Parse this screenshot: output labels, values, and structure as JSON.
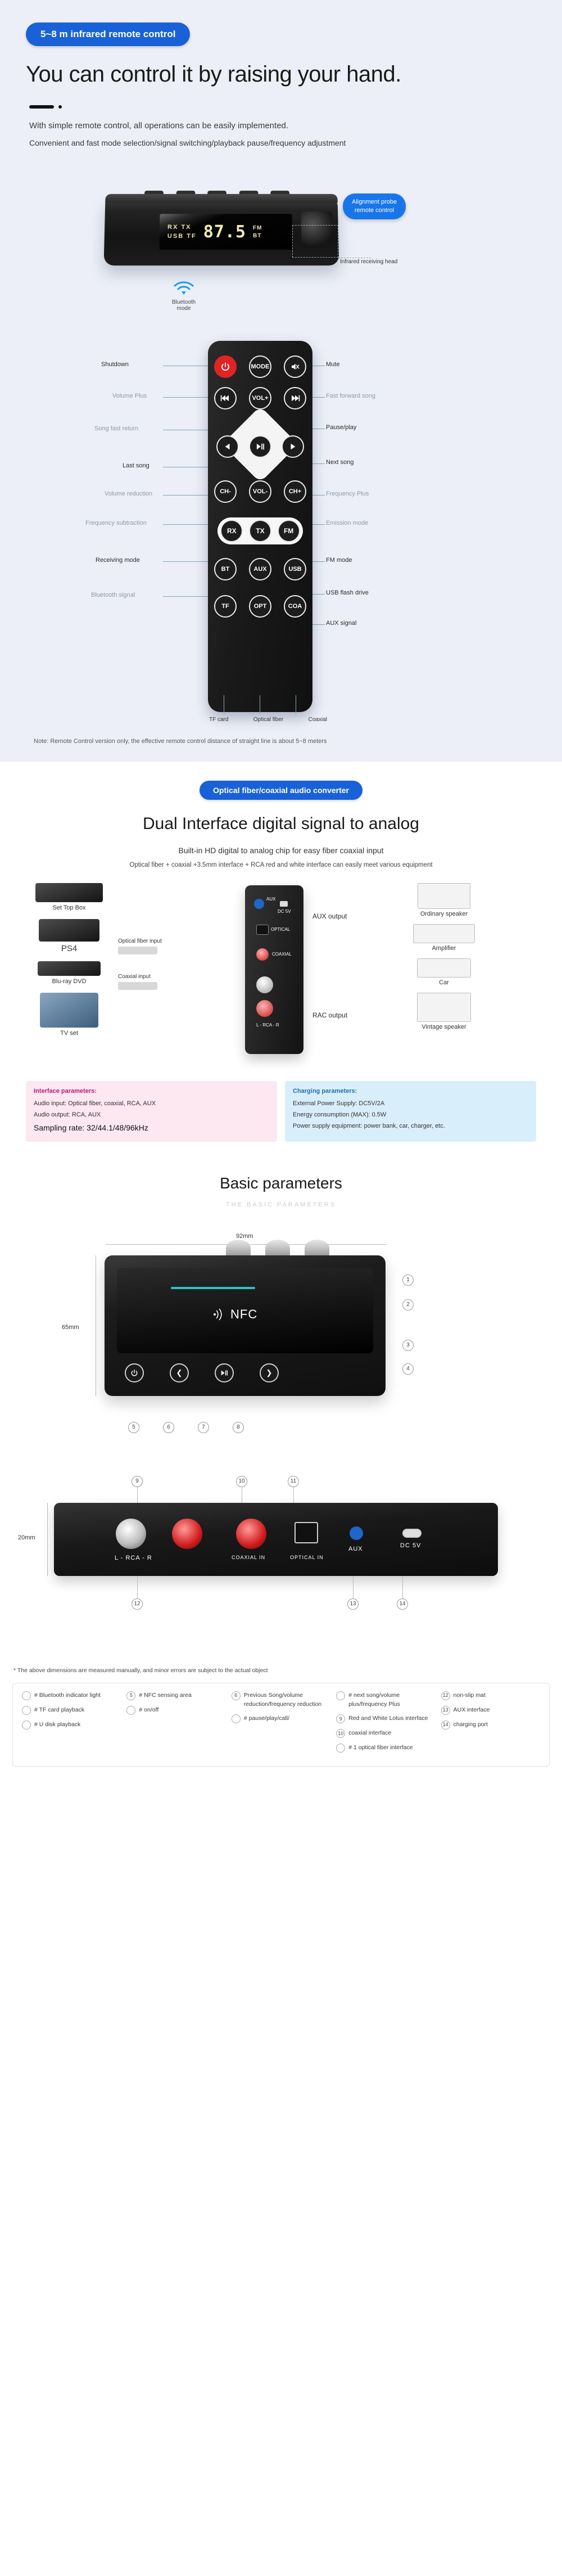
{
  "section_remote": {
    "badge": "5~8 m infrared remote control",
    "heading": "You can control it by raising your hand.",
    "sub1": "With simple remote control, all operations can be easily implemented.",
    "sub2": "Convenient and fast mode selection/signal switching/playback pause/frequency adjustment",
    "display": {
      "line1": "RX TX",
      "line2": "USB TF",
      "digits": "87.5",
      "right1": "FM",
      "right2": "BT"
    },
    "bluetooth_label": "Bluetooth mode",
    "ir_callout": "Alignment probe\nremote control",
    "ir_head_label": "Infrared receiving head",
    "labels_left": [
      "Shutdown",
      "Volume Plus",
      "Song fast return",
      "Last song",
      "Volume reduction",
      "Frequency subtraction",
      "Receiving mode",
      "Bluetooth signal"
    ],
    "labels_right": [
      "Mute",
      "Fast forward song",
      "Pause/play",
      "Next song",
      "Frequency Plus",
      "Emission mode",
      "FM mode",
      "USB flash drive",
      "AUX signal"
    ],
    "buttons": {
      "mode": "MODE",
      "vol_plus": "VOL+",
      "vol_minus": "VOL-",
      "ch_minus": "CH-",
      "ch_plus": "CH+",
      "rx": "RX",
      "tx": "TX",
      "fm": "FM",
      "bt": "BT",
      "aux": "AUX",
      "usb": "USB",
      "tf": "TF",
      "opt": "OPT",
      "coa": "COA"
    },
    "bottom_labels": [
      "TF card",
      "Optical fiber",
      "Coaxial"
    ],
    "note": "Note: Remote Control version only, the effective remote control distance of straight line is about 5~8 meters"
  },
  "section_dual": {
    "badge": "Optical fiber/coaxial audio converter",
    "heading": "Dual Interface digital signal to analog",
    "sub1": "Built-in HD digital to analog chip for easy fiber coaxial input",
    "sub2": "Optical fiber + coaxial +3.5mm interface + RCA red and white interface can easily meet various equipment",
    "sources": [
      {
        "name": "Set Top Box"
      },
      {
        "name": "PS4"
      },
      {
        "name": "Blu-ray DVD"
      },
      {
        "name": "TV set"
      }
    ],
    "inputs": [
      {
        "label": "Optical fiber input"
      },
      {
        "label": "Coaxial input"
      }
    ],
    "device_ports": [
      "AUX",
      "DC 5V",
      "OPTICAL",
      "COAXIAL",
      "L - RCA - R"
    ],
    "outputs_labels": [
      "AUX output",
      "RAC output"
    ],
    "outputs": [
      {
        "name": "Ordinary speaker"
      },
      {
        "name": "Amplifier"
      },
      {
        "name": "Car"
      },
      {
        "name": "Vintage speaker"
      }
    ],
    "param_left": {
      "title": "Interface parameters:",
      "lines": [
        "Audio input: Optical fiber, coaxial, RCA, AUX",
        "Audio output: RCA, AUX"
      ],
      "highlight": "Sampling rate: 32/44.1/48/96kHz"
    },
    "param_right": {
      "title": "Charging parameters:",
      "lines": [
        "External Power Supply: DC5V/2A",
        "Energy consumption (MAX): 0.5W",
        "Power supply equipment: power bank, car, charger, etc."
      ]
    }
  },
  "section_basic": {
    "heading": "Basic parameters",
    "subheading": "THE BASIC PARAMETERS",
    "width_label": "92mm",
    "height_label": "65mm",
    "depth_label": "20mm",
    "nfc_label": "NFC",
    "front_numbers": [
      "1",
      "2",
      "3",
      "4",
      "5",
      "6",
      "7",
      "8"
    ],
    "back_numbers": [
      "9",
      "10",
      "11",
      "12",
      "13",
      "14"
    ],
    "back_ports": [
      "L - RCA - R",
      "COAXIAL IN",
      "OPTICAL IN",
      "AUX",
      "DC 5V"
    ],
    "footnote": "* The above dimensions are measured manually, and minor errors are subject to the actual object",
    "legend": [
      {
        "num": "",
        "text": "# Bluetooth indicator light"
      },
      {
        "num": "",
        "text": "# TF card playback"
      },
      {
        "num": "",
        "text": "# U disk playback"
      },
      {
        "num": "5",
        "text": "# NFC sensing area"
      },
      {
        "num": "",
        "text": "# on/off"
      },
      {
        "num": "6",
        "text": "Previous Song/volume reduction/frequency reduction"
      },
      {
        "num": "",
        "text": "# pause/play/call/"
      },
      {
        "num": "",
        "text": "# next song/volume plus/frequency Plus"
      },
      {
        "num": "9",
        "text": "Red and White Lotus interface"
      },
      {
        "num": "10",
        "text": "coaxial interface"
      },
      {
        "num": "",
        "text": "# 1 optical fiber interface"
      },
      {
        "num": "12",
        "text": "non-slip mat"
      },
      {
        "num": "13",
        "text": "AUX interface"
      },
      {
        "num": "14",
        "text": "charging port"
      }
    ]
  }
}
